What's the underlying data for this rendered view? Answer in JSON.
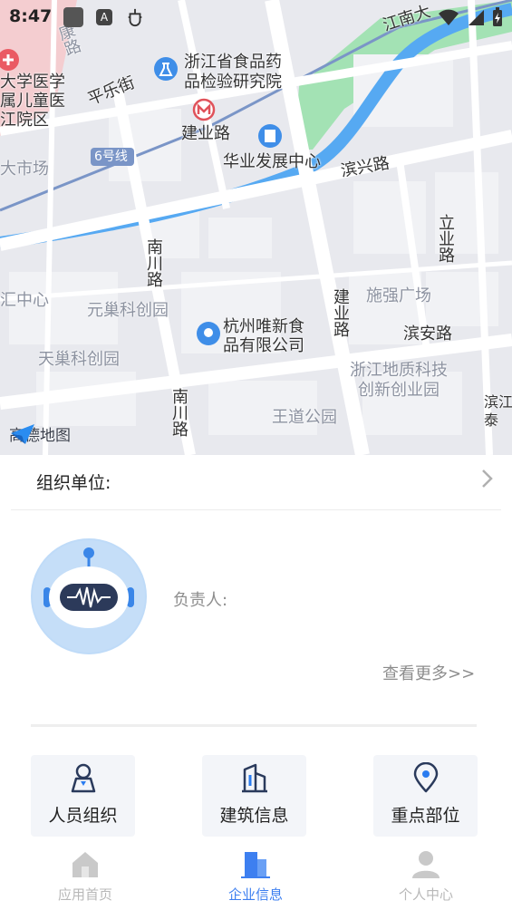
{
  "status_bar": {
    "time": "8:47",
    "icons": [
      "notification-square-icon",
      "a-letter-icon",
      "bug-icon",
      "wifi-icon",
      "signal-icon",
      "battery-charging-icon"
    ]
  },
  "map": {
    "labels": {
      "kang_road": "康路",
      "hospital": "大学医学\n属儿童医\n江院区",
      "pingle_street": "平乐街",
      "food_inst": "浙江省食品药\n品检验研究院",
      "jiangnan_ave": "江南大",
      "jianye_road_n": "建业路",
      "huaye_center": "华业发展中心",
      "line6": "6号线",
      "big_market": "大市场",
      "binxing_road": "滨兴路",
      "liye_road": "立业路",
      "nanchuan_road_n": "南川路",
      "hui_center": "汇中心",
      "yuanchao_park": "元巢科创园",
      "jianye_road_s": "建业路",
      "shiqiang_plaza": "施强广场",
      "weixin_food": "杭州唯新食\n品有限公司",
      "binan_road": "滨安路",
      "tianchao_park": "天巢科创园",
      "geology_park": "浙江地质科技\n创新创业园",
      "nanchuan_road_s": "南川路",
      "wangdao_park": "王道公园",
      "bin_corner": "滨江\n泰"
    },
    "logo_text": "高德地图",
    "colors": {
      "land": "#e8e9ee",
      "road": "#ffffff",
      "river": "#56a9f2",
      "park": "#a3e2b4",
      "metro": "#7a95c7",
      "hospital": "#f4cdd0"
    }
  },
  "org": {
    "label": "组织单位:"
  },
  "person": {
    "owner_label": "负责人:",
    "more_link": "查看更多>>"
  },
  "tiles": [
    {
      "label": "人员组织",
      "icon": "person-badge-icon"
    },
    {
      "label": "建筑信息",
      "icon": "building-icon"
    },
    {
      "label": "重点部位",
      "icon": "location-pin-icon"
    }
  ],
  "nav": {
    "items": [
      {
        "label": "应用首页",
        "icon": "home-icon",
        "active": false
      },
      {
        "label": "企业信息",
        "icon": "enterprise-building-icon",
        "active": true
      },
      {
        "label": "个人中心",
        "icon": "user-icon",
        "active": false
      }
    ],
    "active_color": "#3d7ff0",
    "inactive_color": "#b8b8b8"
  }
}
